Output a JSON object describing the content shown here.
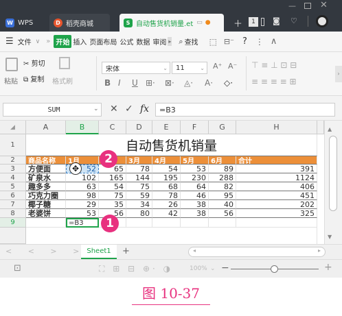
{
  "window": {
    "tabs": [
      {
        "label": "WPS",
        "icon": "wps-logo-icon"
      },
      {
        "label": "稻壳商城",
        "icon": "docer-icon"
      },
      {
        "label": "自动售货机销量.et",
        "icon": "spreadsheet-file-icon"
      }
    ],
    "tab_badge": "1",
    "colors": {
      "titlebar": "#33383f",
      "active_tab": "#f6f6f6",
      "accent_green": "#1ea34a",
      "header_fill": "#ec8f39",
      "marker": "#e8317f"
    }
  },
  "menu": {
    "file": "文件",
    "items": [
      "开始",
      "插入",
      "页面布局",
      "公式",
      "数据",
      "审阅"
    ],
    "search": "查找",
    "help": "?"
  },
  "ribbon": {
    "paste": "粘贴",
    "cut": "剪切",
    "copy": "复制",
    "format_painter": "格式刷",
    "font_name": "宋体",
    "font_size": "11",
    "bold": "B",
    "italic": "I",
    "underline": "U"
  },
  "formula_bar": {
    "name_box": "SUM",
    "cancel": "✕",
    "confirm": "✓",
    "fx": "fx",
    "formula": "=B3"
  },
  "sheet": {
    "columns": [
      "A",
      "B",
      "C",
      "D",
      "E",
      "F",
      "G",
      "H"
    ],
    "rows": [
      "1",
      "2",
      "3",
      "4",
      "5",
      "6",
      "7",
      "8",
      "9"
    ],
    "title": "自动售货机销量",
    "headers": [
      "商品名称",
      "1月",
      "2月",
      "3月",
      "4月",
      "5月",
      "6月",
      "合计"
    ],
    "data": [
      [
        "方便面",
        "52",
        "65",
        "78",
        "54",
        "53",
        "89",
        "391"
      ],
      [
        "矿泉水",
        "102",
        "165",
        "144",
        "195",
        "230",
        "288",
        "1124"
      ],
      [
        "趣多多",
        "63",
        "54",
        "75",
        "68",
        "64",
        "82",
        "406"
      ],
      [
        "巧克力圈",
        "98",
        "75",
        "59",
        "78",
        "46",
        "95",
        "451"
      ],
      [
        "椰子糖",
        "29",
        "35",
        "34",
        "26",
        "38",
        "40",
        "202"
      ],
      [
        "老婆饼",
        "53",
        "56",
        "80",
        "42",
        "38",
        "56",
        "325"
      ]
    ],
    "editing_cell": "=B3",
    "sheet_tab": "Sheet1",
    "add_sheet": "+"
  },
  "statusbar": {
    "zoom": "100%",
    "zoom_out": "−",
    "zoom_in": "+"
  },
  "markers": [
    "1",
    "2"
  ],
  "caption": "图 10-37"
}
